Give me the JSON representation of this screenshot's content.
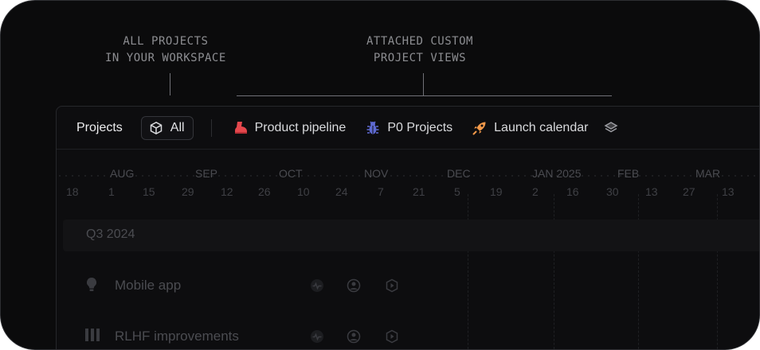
{
  "callouts": {
    "left": "ALL PROJECTS\nIN YOUR WORKSPACE",
    "right": "ATTACHED CUSTOM\nPROJECT VIEWS"
  },
  "toolbar": {
    "title": "Projects",
    "filter_chip": "All",
    "views": [
      {
        "label": "Product pipeline",
        "icon": "boot-icon",
        "color": "#e5484d"
      },
      {
        "label": "P0 Projects",
        "icon": "bug-icon",
        "color": "#5e6ad2"
      },
      {
        "label": "Launch calendar",
        "icon": "rocket-icon",
        "color": "#f2994a"
      }
    ],
    "more_icon": "layers-icon"
  },
  "timeline": {
    "months": [
      "AUG",
      "SEP",
      "OCT",
      "NOV",
      "DEC",
      "JAN 2025",
      "FEB",
      "MAR"
    ],
    "weeks": [
      "18",
      "1",
      "15",
      "29",
      "12",
      "26",
      "10",
      "24",
      "7",
      "21",
      "5",
      "19",
      "2",
      "16",
      "30",
      "13",
      "27",
      "13"
    ]
  },
  "section": {
    "label": "Q3 2024"
  },
  "projects": [
    {
      "name": "Mobile app",
      "icon": "lightbulb-icon"
    },
    {
      "name": "RLHF improvements",
      "icon": "bars-icon"
    }
  ]
}
